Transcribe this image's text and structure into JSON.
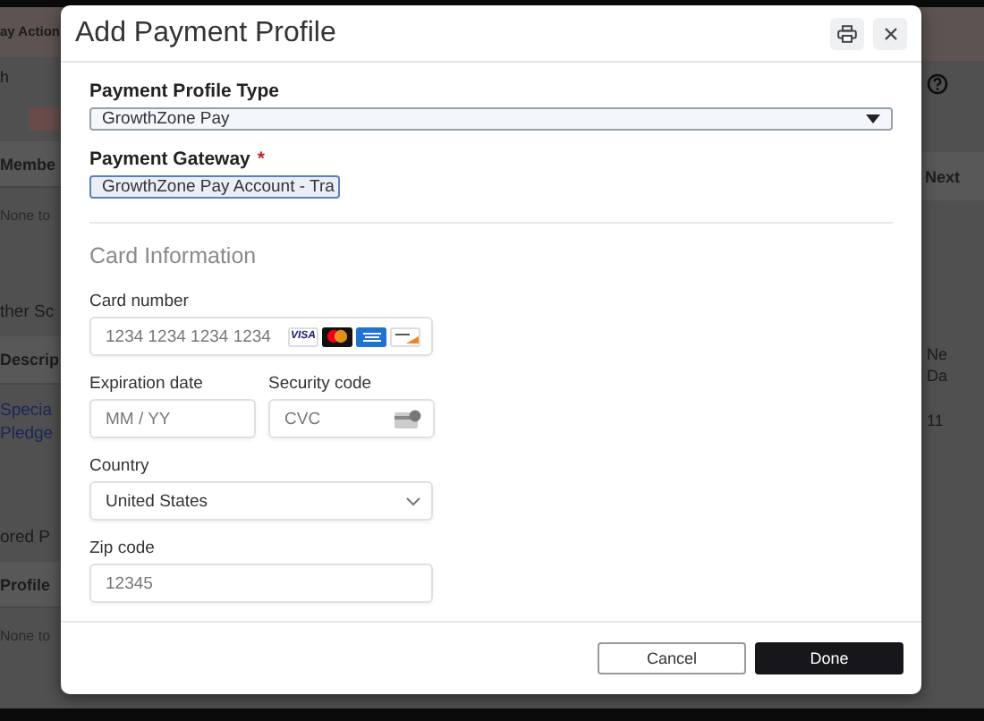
{
  "background_page": {
    "left_items": [
      {
        "kind": "header",
        "text": "ay Action"
      },
      {
        "kind": "search",
        "text": "h"
      },
      {
        "kind": "button"
      },
      {
        "kind": "column",
        "text": "Membe"
      },
      {
        "kind": "empty",
        "text": "None to"
      },
      {
        "kind": "heading",
        "text": "ther Sc"
      },
      {
        "kind": "column",
        "text": "Descrip"
      },
      {
        "kind": "link",
        "text": "Specia Pledge"
      },
      {
        "kind": "heading",
        "text": "ored P"
      },
      {
        "kind": "column",
        "text": "Profile"
      },
      {
        "kind": "empty",
        "text": "None to"
      }
    ],
    "right_items": [
      {
        "kind": "header"
      },
      {
        "kind": "help"
      },
      {
        "kind": "column",
        "text": "Next"
      },
      {
        "kind": "column2",
        "text": "Ne Da"
      },
      {
        "kind": "cell",
        "text": "11"
      }
    ]
  },
  "dialog": {
    "title": "Add Payment Profile",
    "fields": [
      {
        "kind": "select",
        "label": "Payment Profile Type",
        "value": "GrowthZone Pay",
        "wide": true,
        "required": false
      },
      {
        "kind": "select",
        "label": "Payment Gateway",
        "value": "GrowthZone Pay Account - Tra",
        "wide": false,
        "required": true,
        "required_mark": "*"
      }
    ],
    "card_section": {
      "title": "Card Information",
      "card_number": {
        "label": "Card number",
        "placeholder": "1234 1234 1234 1234",
        "brands": [
          {
            "kind": "visa",
            "text": "VISA"
          },
          {
            "kind": "mastercard"
          },
          {
            "kind": "amex"
          },
          {
            "kind": "discover"
          }
        ]
      },
      "expiration": {
        "label": "Expiration date",
        "placeholder": "MM / YY"
      },
      "security": {
        "label": "Security code",
        "placeholder": "CVC"
      },
      "country": {
        "label": "Country",
        "value": "United States"
      },
      "zip": {
        "label": "Zip code",
        "placeholder": "12345"
      }
    },
    "buttons": [
      {
        "kind": "secondary",
        "label": "Cancel"
      },
      {
        "kind": "primary",
        "label": "Done"
      }
    ]
  }
}
